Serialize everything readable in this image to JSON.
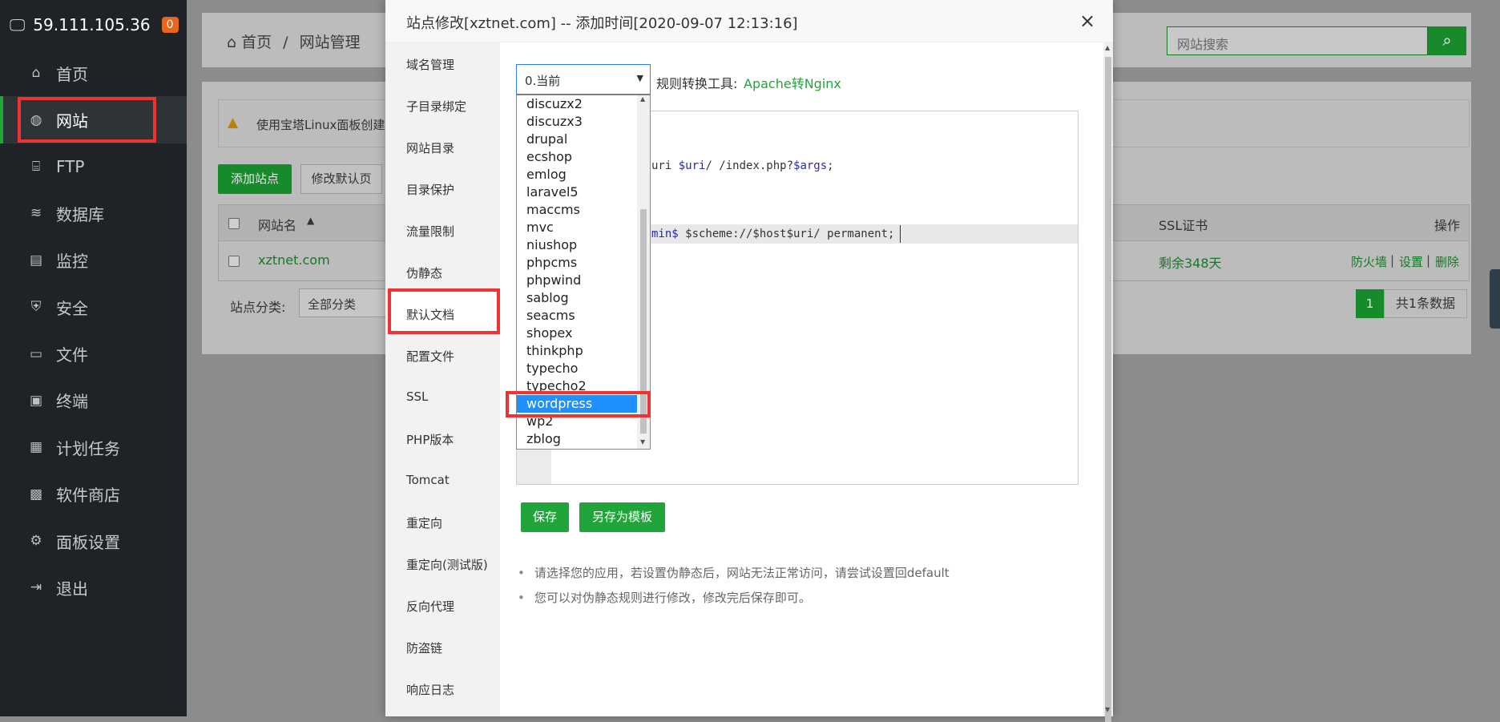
{
  "sidebar": {
    "server_ip": "59.111.105.36",
    "badge": "0",
    "items": [
      {
        "label": "首页",
        "icon": "home-icon",
        "glyph": "⌂"
      },
      {
        "label": "网站",
        "icon": "globe-icon",
        "glyph": "◍"
      },
      {
        "label": "FTP",
        "icon": "ftp-icon",
        "glyph": "⌸"
      },
      {
        "label": "数据库",
        "icon": "database-icon",
        "glyph": "≋"
      },
      {
        "label": "监控",
        "icon": "monitor-icon",
        "glyph": "▤"
      },
      {
        "label": "安全",
        "icon": "shield-icon",
        "glyph": "⛨"
      },
      {
        "label": "文件",
        "icon": "folder-icon",
        "glyph": "▭"
      },
      {
        "label": "终端",
        "icon": "terminal-icon",
        "glyph": "▣"
      },
      {
        "label": "计划任务",
        "icon": "calendar-icon",
        "glyph": "▦"
      },
      {
        "label": "软件商店",
        "icon": "apps-icon",
        "glyph": "▩"
      },
      {
        "label": "面板设置",
        "icon": "gear-icon",
        "glyph": "⚙"
      },
      {
        "label": "退出",
        "icon": "logout-icon",
        "glyph": "⇥"
      }
    ]
  },
  "breadcrumb": {
    "home": "首页",
    "separator": "/",
    "current": "网站管理"
  },
  "search": {
    "placeholder": "网站搜索"
  },
  "notice": "使用宝塔Linux面板创建",
  "toolbar": {
    "add_site": "添加站点",
    "modify_default": "修改默认页"
  },
  "table": {
    "headers": {
      "name": "网站名",
      "ssl": "SSL证书",
      "actions": "操作"
    },
    "row": {
      "name": "xztnet.com",
      "ssl": "剩余348天",
      "firewall": "防火墙",
      "settings": "设置",
      "delete": "删除",
      "sep": "|"
    }
  },
  "filter": {
    "label": "站点分类:",
    "value": "全部分类"
  },
  "pagination": {
    "page": "1",
    "total": "共1条数据"
  },
  "modal": {
    "title": "站点修改[xztnet.com] -- 添加时间[2020-09-07 12:13:16]",
    "close": "×",
    "nav": [
      "域名管理",
      "子目录绑定",
      "网站目录",
      "目录保护",
      "流量限制",
      "伪静态",
      "默认文档",
      "配置文件",
      "SSL",
      "PHP版本",
      "Tomcat",
      "重定向",
      "重定向(测试版)",
      "反向代理",
      "防盗链",
      "响应日志"
    ],
    "rule_select": "0.当前",
    "tool_label": "规则转换工具:",
    "tool_link": "Apache转Nginx",
    "options": [
      "discuzx2",
      "discuzx3",
      "drupal",
      "ecshop",
      "emlog",
      "laravel5",
      "maccms",
      "mvc",
      "niushop",
      "phpcms",
      "phpwind",
      "sablog",
      "seacms",
      "shopex",
      "thinkphp",
      "typecho",
      "typecho2",
      "wordpress",
      "wp2",
      "zblog"
    ],
    "selected_option": "wordpress",
    "code": {
      "line1_a": "uri ",
      "line1_b": "$uri",
      "line1_c": "/ /index.php?",
      "line1_d": "$args",
      "line1_e": ";",
      "line2_a": "min$",
      "line2_b": " $scheme://$host$uri/ permanent;"
    },
    "save": "保存",
    "save_template": "另存为模板",
    "tips": [
      "请选择您的应用，若设置伪静态后，网站无法正常访问，请尝试设置回default",
      "您可以对伪静态规则进行修改，修改完后保存即可。"
    ]
  }
}
